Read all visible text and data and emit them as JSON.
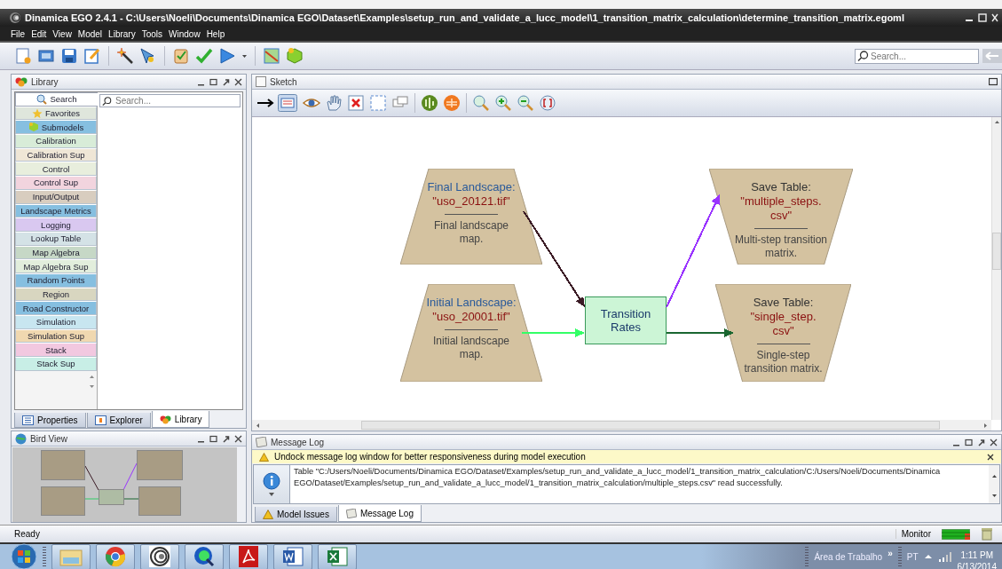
{
  "window": {
    "title": "Dinamica EGO 2.4.1 - C:\\Users\\Noeli\\Documents\\Dinamica EGO\\Dataset\\Examples\\setup_run_and_validate_a_lucc_model\\1_transition_matrix_calculation\\determine_transition_matrix.egoml"
  },
  "menu": [
    "File",
    "Edit",
    "View",
    "Model",
    "Library",
    "Tools",
    "Window",
    "Help"
  ],
  "toolbar_search": {
    "placeholder": "Search..."
  },
  "library": {
    "title": "Library",
    "search_placeholder": "Search...",
    "categories": [
      {
        "label": "Search",
        "selected": true,
        "color": "#ffffff"
      },
      {
        "label": "Favorites",
        "selected": false,
        "color": "#dfe6dc"
      },
      {
        "label": "Submodels",
        "selected": false,
        "color": "#86bfe0"
      },
      {
        "label": "Calibration",
        "selected": false,
        "color": "#d8ecd8"
      },
      {
        "label": "Calibration Sup",
        "selected": false,
        "color": "#efe6d6"
      },
      {
        "label": "Control",
        "selected": false,
        "color": "#e8eedd"
      },
      {
        "label": "Control Sup",
        "selected": false,
        "color": "#f2d4de"
      },
      {
        "label": "Input/Output",
        "selected": false,
        "color": "#d8cdbf"
      },
      {
        "label": "Landscape Metrics",
        "selected": false,
        "color": "#86bfe0"
      },
      {
        "label": "Logging",
        "selected": false,
        "color": "#d9c8f0"
      },
      {
        "label": "Lookup Table",
        "selected": false,
        "color": "#d4e2e6"
      },
      {
        "label": "Map Algebra",
        "selected": false,
        "color": "#c6d8c6"
      },
      {
        "label": "Map Algebra Sup",
        "selected": false,
        "color": "#e2eedc"
      },
      {
        "label": "Random Points",
        "selected": false,
        "color": "#86bfe0"
      },
      {
        "label": "Region",
        "selected": false,
        "color": "#d8d6c0"
      },
      {
        "label": "Road Constructor",
        "selected": false,
        "color": "#86bfe0"
      },
      {
        "label": "Simulation",
        "selected": false,
        "color": "#c8e6f0"
      },
      {
        "label": "Simulation Sup",
        "selected": false,
        "color": "#f0d8b0"
      },
      {
        "label": "Stack",
        "selected": false,
        "color": "#f2c8e0"
      },
      {
        "label": "Stack Sup",
        "selected": false,
        "color": "#c8eee6"
      }
    ],
    "tabs": [
      {
        "label": "Properties",
        "selected": false
      },
      {
        "label": "Explorer",
        "selected": false
      },
      {
        "label": "Library",
        "selected": true
      }
    ]
  },
  "sketch": {
    "title": "Sketch",
    "nodes": [
      {
        "kind": "load",
        "title": "Final Landscape:",
        "file": [
          "\"uso_20121.tif\""
        ],
        "description": "Final landscape map."
      },
      {
        "kind": "load",
        "title": "Initial Landscape:",
        "file": [
          "\"uso_20001.tif\""
        ],
        "description": "Initial landscape map."
      },
      {
        "kind": "calc",
        "title": "Transition Rates"
      },
      {
        "kind": "save",
        "title": "Save Table:",
        "file": [
          "\"multiple_steps.",
          "csv\""
        ],
        "description": "Multi-step transition matrix."
      },
      {
        "kind": "save",
        "title": "Save Table:",
        "file": [
          "\"single_step.",
          "csv\""
        ],
        "description": "Single-step transition matrix."
      }
    ],
    "edges": [
      {
        "color": "#3a1a24"
      },
      {
        "color": "#33ff66"
      },
      {
        "color": "#9933ff"
      },
      {
        "color": "#1a6630"
      }
    ]
  },
  "bird_view": {
    "title": "Bird View"
  },
  "message_log": {
    "title": "Message Log",
    "warning": "Undock message log window for better responsiveness during model execution",
    "message": "Table \"C:/Users/Noeli/Documents/Dinamica EGO/Dataset/Examples/setup_run_and_validate_a_lucc_model/1_transition_matrix_calculation/C:/Users/Noeli/Documents/Dinamica EGO/Dataset/Examples/setup_run_and_validate_a_lucc_model/1_transition_matrix_calculation/multiple_steps.csv\" read successfully.",
    "tabs": [
      {
        "label": "Model Issues",
        "selected": false
      },
      {
        "label": "Message Log",
        "selected": true
      }
    ]
  },
  "status_bar": {
    "text": "Ready",
    "monitor": "Monitor"
  },
  "taskbar": {
    "desktop": "Área de Trabalho",
    "chevron": "»",
    "language": "PT",
    "time": "1:11 PM",
    "date": "6/13/2014"
  }
}
